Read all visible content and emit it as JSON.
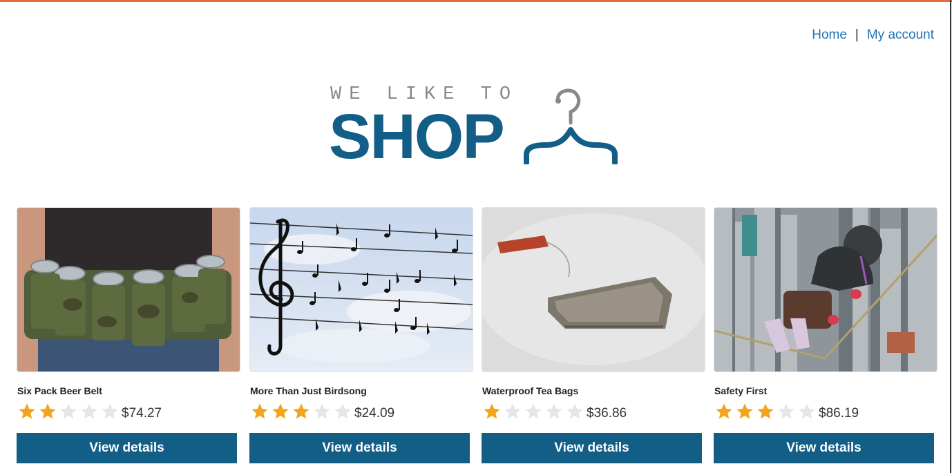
{
  "nav": {
    "home": "Home",
    "separator": "|",
    "account": "My account"
  },
  "logo": {
    "tagline": "WE LIKE TO",
    "word": "SHOP",
    "icon": "hanger-icon"
  },
  "colors": {
    "accent_bar": "#e8693a",
    "brand": "#125e86",
    "link": "#1e72b6",
    "star_filled": "#f2a51c",
    "star_empty": "#e3e6ea"
  },
  "products": [
    {
      "name": "Six Pack Beer Belt",
      "rating": 2,
      "max_rating": 5,
      "price": "$74.27",
      "button": "View details"
    },
    {
      "name": "More Than Just Birdsong",
      "rating": 3,
      "max_rating": 5,
      "price": "$24.09",
      "button": "View details"
    },
    {
      "name": "Waterproof Tea Bags",
      "rating": 1,
      "max_rating": 5,
      "price": "$36.86",
      "button": "View details"
    },
    {
      "name": "Safety First",
      "rating": 3,
      "max_rating": 5,
      "price": "$86.19",
      "button": "View details"
    }
  ]
}
